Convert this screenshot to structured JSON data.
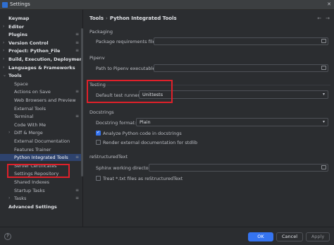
{
  "window": {
    "title": "Settings"
  },
  "sidebar": {
    "items": [
      {
        "label": "Keymap",
        "bold": true,
        "arrow": "",
        "indent": 0
      },
      {
        "label": "Editor",
        "bold": true,
        "arrow": "›",
        "indent": 0
      },
      {
        "label": "Plugins",
        "bold": true,
        "arrow": "",
        "indent": 0,
        "cfg": true
      },
      {
        "label": "Version Control",
        "bold": true,
        "arrow": "›",
        "indent": 0,
        "cfg": true
      },
      {
        "label": "Project: Python_File",
        "bold": true,
        "arrow": "›",
        "indent": 0,
        "cfg": true
      },
      {
        "label": "Build, Execution, Deployment",
        "bold": true,
        "arrow": "›",
        "indent": 0
      },
      {
        "label": "Languages & Frameworks",
        "bold": true,
        "arrow": "›",
        "indent": 0
      },
      {
        "label": "Tools",
        "bold": true,
        "arrow": "⌄",
        "indent": 0
      },
      {
        "label": "Space",
        "indent": 1
      },
      {
        "label": "Actions on Save",
        "indent": 1,
        "cfg": true
      },
      {
        "label": "Web Browsers and Preview",
        "indent": 1
      },
      {
        "label": "External Tools",
        "indent": 1
      },
      {
        "label": "Terminal",
        "indent": 1,
        "cfg": true
      },
      {
        "label": "Code With Me",
        "indent": 1
      },
      {
        "label": "Diff & Merge",
        "indent": 1,
        "arrow": "›"
      },
      {
        "label": "External Documentation",
        "indent": 1
      },
      {
        "label": "Features Trainer",
        "indent": 1
      },
      {
        "label": "Python Integrated Tools",
        "indent": 1,
        "cfg": true,
        "selected": true
      },
      {
        "label": "Server Certificates",
        "indent": 1
      },
      {
        "label": "Settings Repository",
        "indent": 1
      },
      {
        "label": "Shared Indexes",
        "indent": 1
      },
      {
        "label": "Startup Tasks",
        "indent": 1,
        "cfg": true
      },
      {
        "label": "Tasks",
        "indent": 1,
        "arrow": "›",
        "cfg": true
      },
      {
        "label": "Advanced Settings",
        "bold": true,
        "indent": 0
      }
    ]
  },
  "breadcrumb": {
    "parent": "Tools",
    "separator": "›",
    "current": "Python Integrated Tools",
    "reset_icon": "reset-icon"
  },
  "packaging": {
    "title": "Packaging",
    "requirements_label": "Package requirements file:",
    "requirements_value": ""
  },
  "pipenv": {
    "title": "Pipenv",
    "path_label": "Path to Pipenv executable:",
    "path_value": ""
  },
  "testing": {
    "title": "Testing",
    "runner_label": "Default test runner:",
    "runner_value": "Unittests"
  },
  "docstrings": {
    "title": "Docstrings",
    "format_label": "Docstring format:",
    "format_value": "Plain",
    "analyze_label": "Analyze Python code in docstrings",
    "analyze_checked": true,
    "render_label": "Render external documentation for stdlib",
    "render_checked": false
  },
  "restructured": {
    "title": "reStructuredText",
    "sphinx_label": "Sphinx working directory:",
    "sphinx_value": "",
    "treat_label": "Treat *.txt files as reStructuredText",
    "treat_checked": false
  },
  "footer": {
    "help": "?",
    "ok": "OK",
    "cancel": "Cancel",
    "apply": "Apply"
  },
  "colors": {
    "accent": "#3574f0",
    "selection": "#2e436e",
    "highlight": "#e0202a"
  }
}
